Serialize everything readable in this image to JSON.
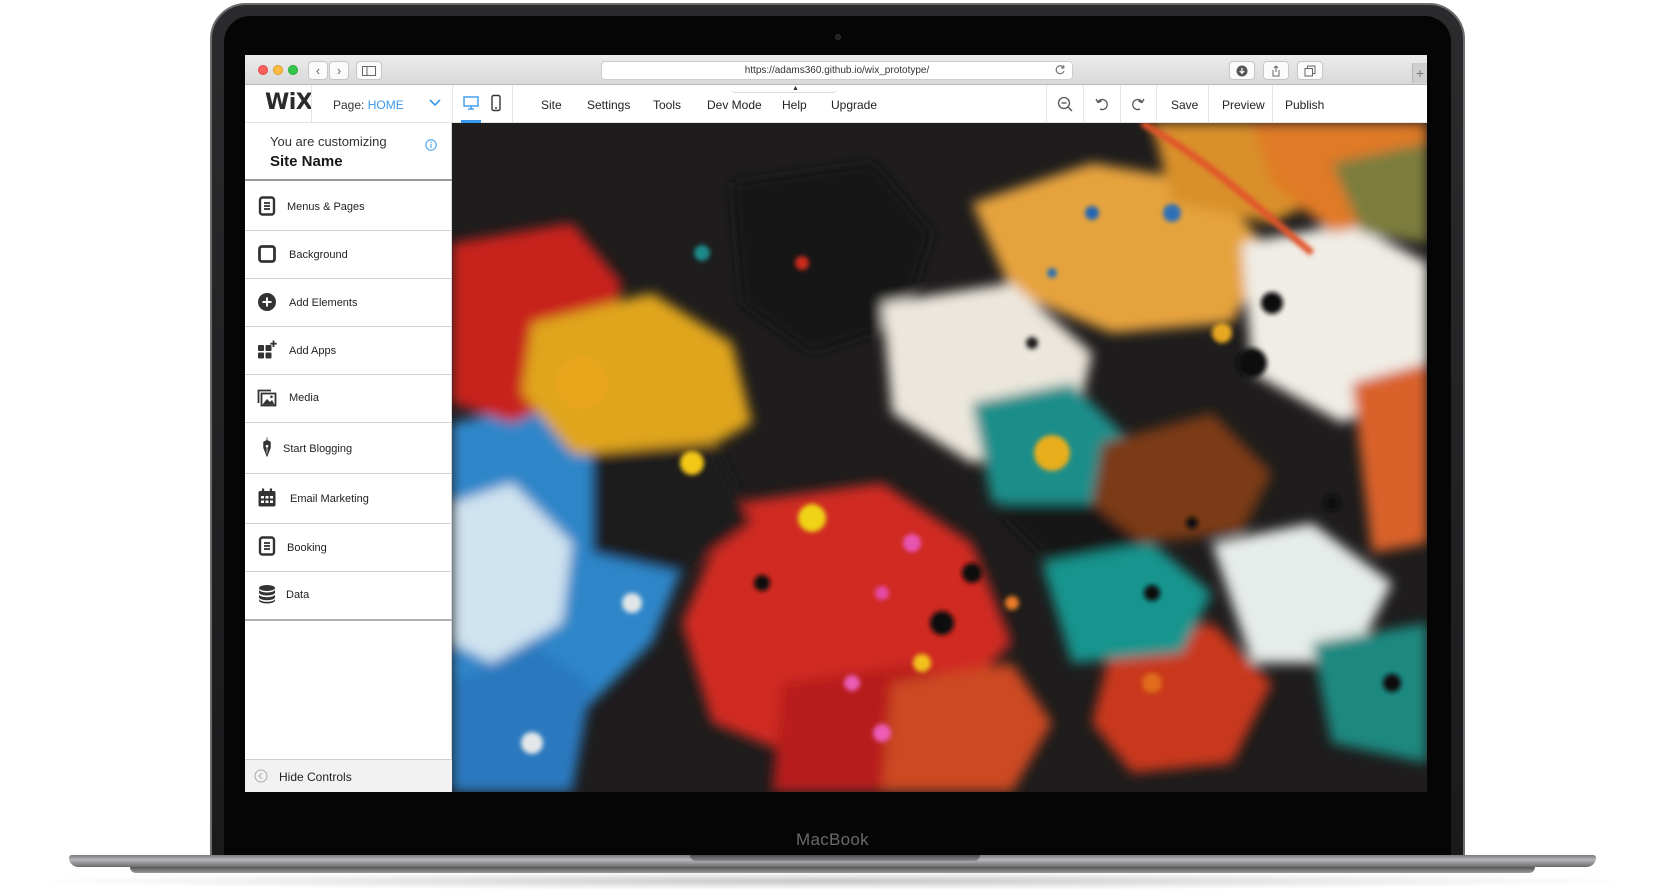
{
  "device": {
    "brand_label": "MacBook"
  },
  "browser": {
    "url": "https://adams360.github.io/wix_prototype/",
    "back_glyph": "‹",
    "forward_glyph": "›",
    "new_tab_glyph": "+"
  },
  "editor": {
    "logo": "WiX",
    "page_select": {
      "label": "Page:",
      "value": "HOME"
    },
    "menu": [
      "Site",
      "Settings",
      "Tools",
      "Dev Mode",
      "Help",
      "Upgrade"
    ],
    "actions": {
      "save": "Save",
      "preview": "Preview",
      "publish": "Publish"
    }
  },
  "sidebar": {
    "subtitle": "You are customizing",
    "site_name": "Site Name",
    "items": [
      {
        "label": "Menus & Pages",
        "icon": "page-icon"
      },
      {
        "label": "Background",
        "icon": "square-icon"
      },
      {
        "label": "Add Elements",
        "icon": "plus-circle-icon"
      },
      {
        "label": "Add Apps",
        "icon": "apps-grid-icon"
      },
      {
        "label": "Media",
        "icon": "media-icon"
      },
      {
        "label": "Start Blogging",
        "icon": "pen-nib-icon"
      },
      {
        "label": "Email Marketing",
        "icon": "calendar-icon"
      },
      {
        "label": "Booking",
        "icon": "page-icon"
      },
      {
        "label": "Data",
        "icon": "database-icon"
      }
    ],
    "hide_controls": "Hide Controls"
  },
  "colors": {
    "accent": "#3899ec",
    "text_dark": "#222222",
    "traffic_red": "#fc605c",
    "traffic_yellow": "#fdbc40",
    "traffic_green": "#34c84a"
  }
}
